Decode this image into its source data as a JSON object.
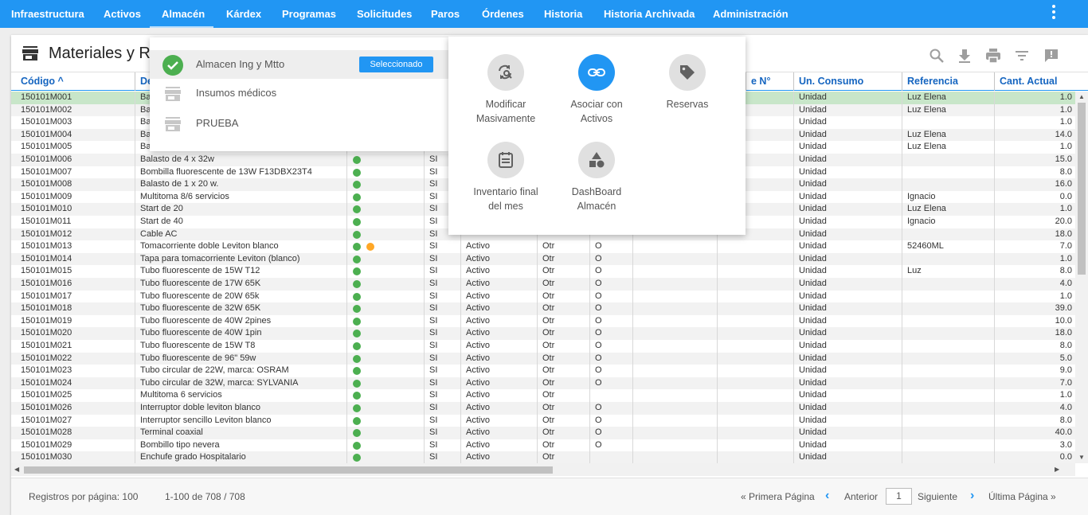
{
  "nav": {
    "items": [
      "Infraestructura",
      "Activos",
      "Almacén",
      "Kárdex",
      "Programas",
      "Solicitudes",
      "Paros",
      "Órdenes",
      "Historia",
      "Historia Archivada",
      "Administración"
    ],
    "active": "Almacén"
  },
  "page": {
    "title": "Materiales y R"
  },
  "toolbar": {
    "icons": [
      "search-icon",
      "download-icon",
      "print-icon",
      "filter-icon",
      "feedback-icon"
    ]
  },
  "table": {
    "headers": [
      "Código ^",
      "De",
      "",
      "",
      "",
      "",
      "e N°",
      "",
      "Un. Consumo",
      "Referencia",
      "Cant. Actual"
    ],
    "rows": [
      {
        "code": "150101M001",
        "desc": "Ba",
        "s1": "",
        "s2": "",
        "st": "",
        "t": "",
        "o": "",
        "unit": "Unidad",
        "ref": "Luz Elena",
        "qty": "1.0"
      },
      {
        "code": "150101M002",
        "desc": "Ba",
        "s1": "",
        "s2": "",
        "st": "",
        "t": "",
        "o": "",
        "unit": "Unidad",
        "ref": "Luz Elena",
        "qty": "1.0"
      },
      {
        "code": "150101M003",
        "desc": "Ba",
        "s1": "",
        "s2": "",
        "st": "",
        "t": "",
        "o": "",
        "unit": "Unidad",
        "ref": "",
        "qty": "1.0"
      },
      {
        "code": "150101M004",
        "desc": "Ba",
        "s1": "",
        "s2": "",
        "st": "",
        "t": "",
        "o": "",
        "unit": "Unidad",
        "ref": "Luz Elena",
        "qty": "14.0"
      },
      {
        "code": "150101M005",
        "desc": "Ba",
        "s1": "",
        "s2": "",
        "st": "",
        "t": "",
        "o": "",
        "unit": "Unidad",
        "ref": "Luz Elena",
        "qty": "1.0"
      },
      {
        "code": "150101M006",
        "desc": "Balasto de 4 x 32w",
        "s1": "g",
        "s2": "",
        "st": "SI",
        "t": "",
        "o": "",
        "unit": "Unidad",
        "ref": "",
        "qty": "15.0"
      },
      {
        "code": "150101M007",
        "desc": "Bombilla fluorescente de 13W F13DBX23T4",
        "s1": "g",
        "s2": "",
        "st": "SI",
        "t": "",
        "o": "",
        "unit": "Unidad",
        "ref": "",
        "qty": "8.0"
      },
      {
        "code": "150101M008",
        "desc": "Balasto de 1 x 20 w.",
        "s1": "g",
        "s2": "",
        "st": "SI",
        "t": "",
        "o": "",
        "unit": "Unidad",
        "ref": "",
        "qty": "16.0"
      },
      {
        "code": "150101M009",
        "desc": "Multitoma 8/6 servicios",
        "s1": "g",
        "s2": "",
        "st": "SI",
        "t": "",
        "o": "",
        "unit": "Unidad",
        "ref": "Ignacio",
        "qty": "0.0"
      },
      {
        "code": "150101M010",
        "desc": "Start de 20",
        "s1": "g",
        "s2": "",
        "st": "SI",
        "t": "",
        "o": "",
        "unit": "Unidad",
        "ref": "Luz Elena",
        "qty": "1.0"
      },
      {
        "code": "150101M011",
        "desc": "Start de 40",
        "s1": "g",
        "s2": "",
        "st": "SI",
        "t": "",
        "o": "",
        "unit": "Unidad",
        "ref": "Ignacio",
        "qty": "20.0"
      },
      {
        "code": "150101M012",
        "desc": "Cable AC",
        "s1": "g",
        "s2": "",
        "st": "SI",
        "t": "",
        "o": "",
        "unit": "Unidad",
        "ref": "",
        "qty": "18.0"
      },
      {
        "code": "150101M013",
        "desc": "Tomacorriente doble Leviton blanco",
        "s1": "g",
        "s2": "o",
        "st": "SI",
        "a": "Activo",
        "t": "Otr",
        "o": "O",
        "unit": "Unidad",
        "ref": "52460ML",
        "qty": "7.0"
      },
      {
        "code": "150101M014",
        "desc": "Tapa para tomacorriente Leviton (blanco)",
        "s1": "g",
        "s2": "",
        "st": "SI",
        "a": "Activo",
        "t": "Otr",
        "o": "O",
        "unit": "Unidad",
        "ref": "",
        "qty": "1.0"
      },
      {
        "code": "150101M015",
        "desc": "Tubo fluorescente de 15W T12",
        "s1": "g",
        "s2": "",
        "st": "SI",
        "a": "Activo",
        "t": "Otr",
        "o": "O",
        "unit": "Unidad",
        "ref": "Luz",
        "qty": "8.0"
      },
      {
        "code": "150101M016",
        "desc": "Tubo fluorescente de 17W 65K",
        "s1": "g",
        "s2": "",
        "st": "SI",
        "a": "Activo",
        "t": "Otr",
        "o": "O",
        "unit": "Unidad",
        "ref": "",
        "qty": "4.0"
      },
      {
        "code": "150101M017",
        "desc": "Tubo fluorescente de 20W 65k",
        "s1": "g",
        "s2": "",
        "st": "SI",
        "a": "Activo",
        "t": "Otr",
        "o": "O",
        "unit": "Unidad",
        "ref": "",
        "qty": "1.0"
      },
      {
        "code": "150101M018",
        "desc": "Tubo fluorescente de 32W 65K",
        "s1": "g",
        "s2": "",
        "st": "SI",
        "a": "Activo",
        "t": "Otr",
        "o": "O",
        "unit": "Unidad",
        "ref": "",
        "qty": "39.0"
      },
      {
        "code": "150101M019",
        "desc": "Tubo fluorescente de 40W 2pines",
        "s1": "g",
        "s2": "",
        "st": "SI",
        "a": "Activo",
        "t": "Otr",
        "o": "O",
        "unit": "Unidad",
        "ref": "",
        "qty": "10.0"
      },
      {
        "code": "150101M020",
        "desc": "Tubo fluorescente de 40W 1pin",
        "s1": "g",
        "s2": "",
        "st": "SI",
        "a": "Activo",
        "t": "Otr",
        "o": "O",
        "unit": "Unidad",
        "ref": "",
        "qty": "18.0"
      },
      {
        "code": "150101M021",
        "desc": "Tubo fluorescente de 15W T8",
        "s1": "g",
        "s2": "",
        "st": "SI",
        "a": "Activo",
        "t": "Otr",
        "o": "O",
        "unit": "Unidad",
        "ref": "",
        "qty": "8.0"
      },
      {
        "code": "150101M022",
        "desc": "Tubo fluorescente de 96\" 59w",
        "s1": "g",
        "s2": "",
        "st": "SI",
        "a": "Activo",
        "t": "Otr",
        "o": "O",
        "unit": "Unidad",
        "ref": "",
        "qty": "5.0"
      },
      {
        "code": "150101M023",
        "desc": "Tubo circular de 22W, marca: OSRAM",
        "s1": "g",
        "s2": "",
        "st": "SI",
        "a": "Activo",
        "t": "Otr",
        "o": "O",
        "unit": "Unidad",
        "ref": "",
        "qty": "9.0"
      },
      {
        "code": "150101M024",
        "desc": "Tubo circular de 32W, marca: SYLVANIA",
        "s1": "g",
        "s2": "",
        "st": "SI",
        "a": "Activo",
        "t": "Otr",
        "o": "O",
        "unit": "Unidad",
        "ref": "",
        "qty": "7.0"
      },
      {
        "code": "150101M025",
        "desc": "Multitoma 6 servicios",
        "s1": "g",
        "s2": "",
        "st": "SI",
        "a": "Activo",
        "t": "Otr",
        "o": "",
        "unit": "Unidad",
        "ref": "",
        "qty": "1.0"
      },
      {
        "code": "150101M026",
        "desc": "Interruptor doble leviton blanco",
        "s1": "g",
        "s2": "",
        "st": "SI",
        "a": "Activo",
        "t": "Otr",
        "o": "O",
        "unit": "Unidad",
        "ref": "",
        "qty": "4.0"
      },
      {
        "code": "150101M027",
        "desc": "Interruptor sencillo Leviton blanco",
        "s1": "g",
        "s2": "",
        "st": "SI",
        "a": "Activo",
        "t": "Otr",
        "o": "O",
        "unit": "Unidad",
        "ref": "",
        "qty": "8.0"
      },
      {
        "code": "150101M028",
        "desc": "Terminal coaxial",
        "s1": "g",
        "s2": "",
        "st": "SI",
        "a": "Activo",
        "t": "Otr",
        "o": "O",
        "unit": "Unidad",
        "ref": "",
        "qty": "40.0"
      },
      {
        "code": "150101M029",
        "desc": "Bombillo tipo nevera",
        "s1": "g",
        "s2": "",
        "st": "SI",
        "a": "Activo",
        "t": "Otr",
        "o": "O",
        "unit": "Unidad",
        "ref": "",
        "qty": "3.0"
      },
      {
        "code": "150101M030",
        "desc": "Enchufe grado Hospitalario",
        "s1": "g",
        "s2": "",
        "st": "SI",
        "a": "Activo",
        "t": "Otr",
        "o": "",
        "unit": "Unidad",
        "ref": "",
        "qty": "0.0"
      }
    ]
  },
  "dropdown": {
    "items": [
      {
        "label": "Almacen Ing y Mtto",
        "selected": true
      },
      {
        "label": "Insumos médicos",
        "selected": false
      },
      {
        "label": "PRUEBA",
        "selected": false
      }
    ],
    "selected_badge": "Seleccionado"
  },
  "apps": [
    {
      "label1": "Modificar",
      "label2": "Masivamente",
      "icon": "refresh-search-icon",
      "color": "#e0e0e0"
    },
    {
      "label1": "Asociar con",
      "label2": "Activos",
      "icon": "link-icon",
      "color": "#2196f3"
    },
    {
      "label1": "Reservas",
      "label2": "",
      "icon": "tag-icon",
      "color": "#e0e0e0"
    },
    {
      "label1": "Inventario final",
      "label2": "del mes",
      "icon": "calendar-list-icon",
      "color": "#e0e0e0"
    },
    {
      "label1": "DashBoard",
      "label2": "Almacén",
      "icon": "shapes-icon",
      "color": "#e0e0e0"
    }
  ],
  "footer": {
    "per_page": "Registros por página: 100",
    "range": "1-100 de 708 / 708",
    "first": "« Primera Página",
    "prev": "Anterior",
    "page": "1",
    "next": "Siguiente",
    "last": "Última Página »"
  },
  "colors": {
    "primary": "#2196f3",
    "selected_row": "#c8e6c9",
    "status_green": "#4caf50",
    "status_orange": "#ffa726"
  }
}
